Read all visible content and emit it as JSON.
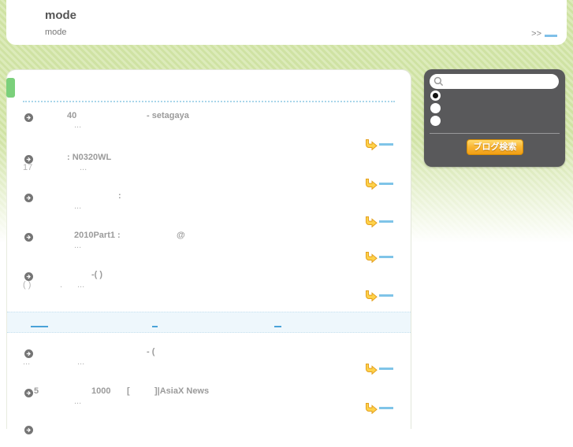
{
  "page": {
    "bg_green": "#cfe2a3",
    "accent_blue": "#7fc4e8",
    "panel_gray": "#59595b",
    "button_orange": "#f29e14",
    "tab_green": "#7bd07b"
  },
  "header": {
    "title": "mode",
    "subtitle": "mode",
    "more_label": ">>"
  },
  "search_panel": {
    "input_value": "",
    "input_placeholder": "",
    "radio_count": 3,
    "radio_selected_index": 0,
    "button_label": "ブログ検索",
    "search_icon": "magnifier-icon"
  },
  "results": {
    "item_icon": "arrow-circle-icon",
    "more_icon": "curved-arrow-icon",
    "items": [
      {
        "title_parts": [
          "40",
          "- setagaya"
        ],
        "snippet_parts": [
          "..."
        ]
      },
      {
        "title_parts": [
          ": N0320WL"
        ],
        "snippet_parts": [
          "17",
          "..."
        ]
      },
      {
        "title_parts": [
          ":"
        ],
        "snippet_parts": [
          "..."
        ]
      },
      {
        "title_parts": [
          "2010Part1 :",
          "@"
        ],
        "snippet_parts": [
          "..."
        ]
      },
      {
        "title_parts": [
          "-( )"
        ],
        "snippet_parts": [
          "( )",
          ".",
          "..."
        ]
      },
      {
        "title_parts": [
          "- ("
        ],
        "snippet_parts": [
          "...",
          "..."
        ]
      },
      {
        "title_parts": [
          "5",
          "1000",
          "[",
          "]|AsiaX News"
        ],
        "snippet_parts": [
          "..."
        ]
      }
    ]
  }
}
